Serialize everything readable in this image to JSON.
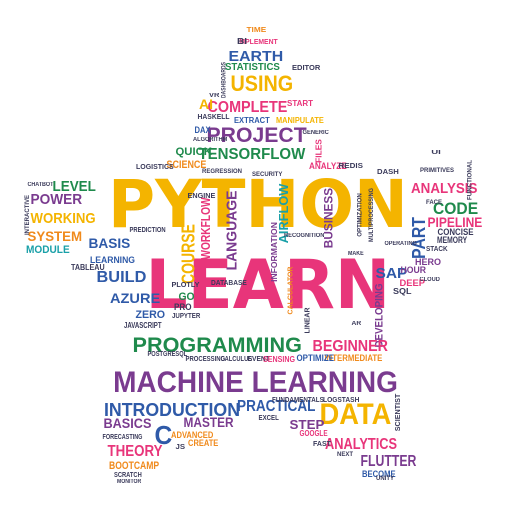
{
  "palette": {
    "yellow": "#f4b400",
    "pink": "#e8357a",
    "purple": "#7a3b8f",
    "blue": "#2f5aa8",
    "green": "#1f8a4c",
    "orange": "#f08a1c",
    "teal": "#1aa0a8",
    "dark": "#3a3a5a"
  },
  "words": [
    {
      "text": "PYTHON",
      "color": "yellow",
      "rot": 0
    },
    {
      "text": "LEARN",
      "color": "pink",
      "rot": 0
    },
    {
      "text": "MACHINE LEARNING",
      "color": "purple",
      "rot": 0
    },
    {
      "text": "PROGRAMMING",
      "color": "green",
      "rot": 0
    },
    {
      "text": "DATA",
      "color": "yellow",
      "rot": 0
    },
    {
      "text": "INTRODUCTION",
      "color": "blue",
      "rot": 0
    },
    {
      "text": "PROJECT",
      "color": "purple",
      "rot": 0
    },
    {
      "text": "TENSORFLOW",
      "color": "green",
      "rot": 0
    },
    {
      "text": "USING",
      "color": "yellow",
      "rot": 0
    },
    {
      "text": "COMPLETE",
      "color": "pink",
      "rot": 0
    },
    {
      "text": "EARTH",
      "color": "blue",
      "rot": 0
    },
    {
      "text": "STATISTICS",
      "color": "green",
      "rot": 0
    },
    {
      "text": "LEVEL",
      "color": "green",
      "rot": 0
    },
    {
      "text": "POWER",
      "color": "purple",
      "rot": 0
    },
    {
      "text": "WORKING",
      "color": "yellow",
      "rot": 0
    },
    {
      "text": "SYSTEM",
      "color": "orange",
      "rot": 0
    },
    {
      "text": "MODULE",
      "color": "teal",
      "rot": 0
    },
    {
      "text": "LEARNING",
      "color": "blue",
      "rot": 0
    },
    {
      "text": "BASIS",
      "color": "blue",
      "rot": 0
    },
    {
      "text": "BUILD",
      "color": "blue",
      "rot": 0
    },
    {
      "text": "AZURE",
      "color": "blue",
      "rot": 0
    },
    {
      "text": "ZERO",
      "color": "blue",
      "rot": 0
    },
    {
      "text": "COURSE",
      "color": "yellow",
      "rot": -90
    },
    {
      "text": "WORKFLOW",
      "color": "pink",
      "rot": -90
    },
    {
      "text": "LANGUAGE",
      "color": "purple",
      "rot": -90
    },
    {
      "text": "AIRFLOW",
      "color": "teal",
      "rot": -90
    },
    {
      "text": "BUSINESS",
      "color": "purple",
      "rot": -90
    },
    {
      "text": "ANALYSIS",
      "color": "pink",
      "rot": 0
    },
    {
      "text": "CODE",
      "color": "green",
      "rot": 0
    },
    {
      "text": "PIPELINE",
      "color": "pink",
      "rot": 0
    },
    {
      "text": "PART",
      "color": "blue",
      "rot": -90
    },
    {
      "text": "SAP",
      "color": "blue",
      "rot": 0
    },
    {
      "text": "HERO",
      "color": "purple",
      "rot": 0
    },
    {
      "text": "HOUR",
      "color": "purple",
      "rot": 0
    },
    {
      "text": "DEEP",
      "color": "pink",
      "rot": 0
    },
    {
      "text": "DEVELOPING",
      "color": "purple",
      "rot": -90
    },
    {
      "text": "BEGINNER",
      "color": "pink",
      "rot": 0
    },
    {
      "text": "INTERMEDIATE",
      "color": "orange",
      "rot": 0
    },
    {
      "text": "PRACTICAL",
      "color": "blue",
      "rot": 0
    },
    {
      "text": "MASTER",
      "color": "purple",
      "rot": 0
    },
    {
      "text": "BASICS",
      "color": "purple",
      "rot": 0
    },
    {
      "text": "THEORY",
      "color": "pink",
      "rot": 0
    },
    {
      "text": "BOOTCAMP",
      "color": "orange",
      "rot": 0
    },
    {
      "text": "STEP",
      "color": "purple",
      "rot": 0
    },
    {
      "text": "ANALYTICS",
      "color": "pink",
      "rot": 0
    },
    {
      "text": "FLUTTER",
      "color": "purple",
      "rot": 0
    },
    {
      "text": "BECOME",
      "color": "blue",
      "rot": 0
    },
    {
      "text": "ADVANCED",
      "color": "orange",
      "rot": 0
    },
    {
      "text": "CREATE",
      "color": "orange",
      "rot": 0
    },
    {
      "text": "AI",
      "color": "yellow",
      "rot": 0
    },
    {
      "text": "SCIENCE",
      "color": "orange",
      "rot": 0
    },
    {
      "text": "QUICK",
      "color": "green",
      "rot": 0
    },
    {
      "text": "DAX",
      "color": "blue",
      "rot": 0
    },
    {
      "text": "EXTRACT",
      "color": "blue",
      "rot": 0
    },
    {
      "text": "MANIPULATE",
      "color": "yellow",
      "rot": 0
    },
    {
      "text": "START",
      "color": "pink",
      "rot": 0
    },
    {
      "text": "ANALYZE",
      "color": "pink",
      "rot": 0
    },
    {
      "text": "TIME",
      "color": "orange",
      "rot": 0
    },
    {
      "text": "IMPLEMENT",
      "color": "pink",
      "rot": 0
    },
    {
      "text": "EDITOR",
      "color": "dark",
      "rot": 0
    },
    {
      "text": "HASKELL",
      "color": "dark",
      "rot": 0
    },
    {
      "text": "FILES",
      "color": "pink",
      "rot": -90
    },
    {
      "text": "REDIS",
      "color": "dark",
      "rot": 0
    },
    {
      "text": "DASH",
      "color": "dark",
      "rot": 0
    },
    {
      "text": "LOGISTICS",
      "color": "dark",
      "rot": 0
    },
    {
      "text": "ENGINE",
      "color": "dark",
      "rot": 0
    },
    {
      "text": "INFORMATION",
      "color": "purple",
      "rot": -90
    },
    {
      "text": "CALCULATOR",
      "color": "orange",
      "rot": -90
    },
    {
      "text": "DATABASE",
      "color": "dark",
      "rot": 0
    },
    {
      "text": "PROCESSING",
      "color": "dark",
      "rot": 0
    },
    {
      "text": "CALCULUS",
      "color": "dark",
      "rot": 0
    },
    {
      "text": "EVENT",
      "color": "dark",
      "rot": 0
    },
    {
      "text": "SENSING",
      "color": "pink",
      "rot": 0
    },
    {
      "text": "OPTIMIZE",
      "color": "blue",
      "rot": 0
    },
    {
      "text": "FUNDAMENTALS",
      "color": "dark",
      "rot": 0
    },
    {
      "text": "LOGSTASH",
      "color": "dark",
      "rot": 0
    },
    {
      "text": "GOOGLE",
      "color": "pink",
      "rot": 0
    },
    {
      "text": "FAST",
      "color": "dark",
      "rot": 0
    },
    {
      "text": "SCIENTIST",
      "color": "dark",
      "rot": -90
    },
    {
      "text": "CONCISE",
      "color": "dark",
      "rot": 0
    },
    {
      "text": "MEMORY",
      "color": "dark",
      "rot": 0
    },
    {
      "text": "STACK",
      "color": "dark",
      "rot": 0
    },
    {
      "text": "SQL",
      "color": "dark",
      "rot": 0
    },
    {
      "text": "JAVASCRIPT",
      "color": "dark",
      "rot": 0
    },
    {
      "text": "PLOTLY",
      "color": "dark",
      "rot": 0
    },
    {
      "text": "GO",
      "color": "green",
      "rot": 0
    },
    {
      "text": "PRO",
      "color": "dark",
      "rot": 0
    },
    {
      "text": "JUPYTER",
      "color": "dark",
      "rot": 0
    },
    {
      "text": "FORECASTING",
      "color": "dark",
      "rot": 0
    },
    {
      "text": "SCRATCH",
      "color": "dark",
      "rot": 0
    },
    {
      "text": "MONITOR",
      "color": "dark",
      "rot": 0
    },
    {
      "text": "JS",
      "color": "dark",
      "rot": 0
    },
    {
      "text": "C",
      "color": "blue",
      "rot": 0
    },
    {
      "text": "EXCEL",
      "color": "dark",
      "rot": 0
    },
    {
      "text": "POSTGRESQL",
      "color": "dark",
      "rot": 0
    },
    {
      "text": "TABLEAU",
      "color": "dark",
      "rot": 0
    },
    {
      "text": "PREDICTION",
      "color": "dark",
      "rot": 0
    },
    {
      "text": "CHATBOT",
      "color": "dark",
      "rot": 0
    },
    {
      "text": "INTERACTIVE",
      "color": "dark",
      "rot": -90
    },
    {
      "text": "RECOGNITION",
      "color": "dark",
      "rot": 0
    },
    {
      "text": "OPTIMIZATION",
      "color": "dark",
      "rot": -90
    },
    {
      "text": "MULTIPROCESSING",
      "color": "dark",
      "rot": -90
    },
    {
      "text": "LINEAR",
      "color": "dark",
      "rot": -90
    },
    {
      "text": "REGRESSION",
      "color": "dark",
      "rot": 0
    },
    {
      "text": "FUNCTIONAL",
      "color": "dark",
      "rot": -90
    },
    {
      "text": "FACE",
      "color": "dark",
      "rot": 0
    },
    {
      "text": "PRIMITIVES",
      "color": "dark",
      "rot": 0
    },
    {
      "text": "OPERATING",
      "color": "dark",
      "rot": 0
    },
    {
      "text": "CLOUD",
      "color": "dark",
      "rot": 0
    },
    {
      "text": "UNITY",
      "color": "dark",
      "rot": 0
    },
    {
      "text": "ALGORITHM",
      "color": "dark",
      "rot": 0
    },
    {
      "text": "DASHBOARDS",
      "color": "dark",
      "rot": -90
    },
    {
      "text": "NEXT",
      "color": "dark",
      "rot": 0
    },
    {
      "text": "MAKE",
      "color": "dark",
      "rot": 0
    },
    {
      "text": "SECURITY",
      "color": "dark",
      "rot": 0
    },
    {
      "text": "GENERIC",
      "color": "dark",
      "rot": 0
    },
    {
      "text": "VR",
      "color": "dark",
      "rot": 0
    },
    {
      "text": "AR",
      "color": "dark",
      "rot": 0
    },
    {
      "text": "UI",
      "color": "dark",
      "rot": 0
    },
    {
      "text": "BI",
      "color": "dark",
      "rot": 0
    }
  ]
}
